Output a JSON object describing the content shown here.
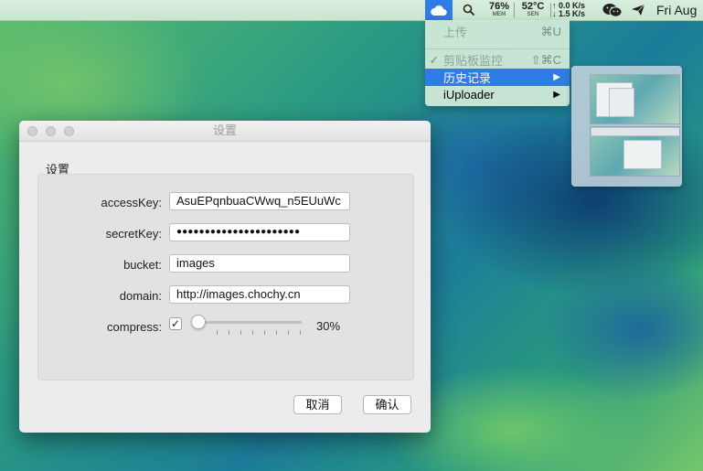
{
  "menubar": {
    "mem_value": "76%",
    "mem_label": "MEM",
    "temp_value": "52°C",
    "temp_label": "SEN",
    "net_up": "↑ 0.0 K/s",
    "net_down": "↓ 1.5 K/s",
    "date": "Fri Aug",
    "accent_color": "#2f7ce6",
    "icons": [
      "cloud-icon",
      "search-icon",
      "wechat-icon",
      "paper-plane-icon"
    ]
  },
  "menu": {
    "items": [
      {
        "label": "上传",
        "shortcut": "⌘U",
        "state": "disabled"
      },
      {
        "label": "剪贴板监控",
        "shortcut": "⇧⌘C",
        "state": "checked"
      },
      {
        "label": "历史记录",
        "shortcut": "▶",
        "state": "active"
      },
      {
        "label": "iUploader",
        "shortcut": "▶",
        "state": "normal"
      }
    ]
  },
  "dialog": {
    "title": "设置",
    "group_title": "设置",
    "fields": [
      {
        "label": "accessKey:",
        "value": "AsuEPqnbuaCWwq_n5EUuWc"
      },
      {
        "label": "secretKey:",
        "value": "●●●●●●●●●●●●●●●●●●●●●●"
      },
      {
        "label": "bucket:",
        "value": "images"
      },
      {
        "label": "domain:",
        "value": "http://images.chochy.cn"
      }
    ],
    "compress": {
      "label": "compress:",
      "checked": true,
      "check_mark": "✓",
      "percent_text": "30%"
    },
    "buttons": {
      "cancel": "取消",
      "ok": "确认"
    }
  }
}
